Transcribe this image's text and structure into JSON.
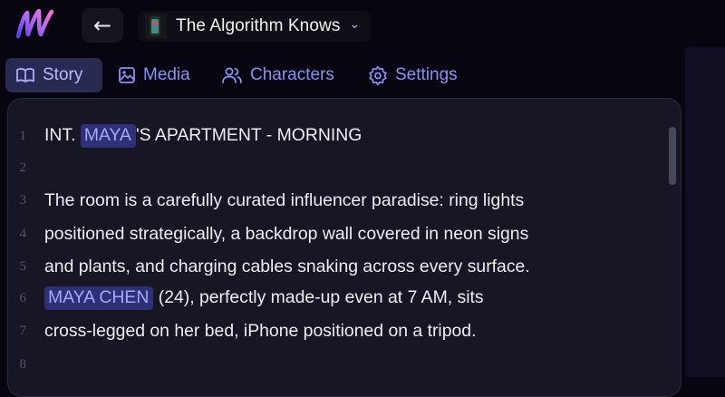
{
  "header": {
    "back_arrow": "←",
    "project_title": "The Algorithm Knows",
    "dropdown_caret": "⌄"
  },
  "tabs": [
    {
      "label": "Story",
      "icon": "book-icon",
      "active": true
    },
    {
      "label": "Media",
      "icon": "image-icon",
      "active": false
    },
    {
      "label": "Characters",
      "icon": "users-icon",
      "active": false
    },
    {
      "label": "Settings",
      "icon": "gear-icon",
      "active": false
    }
  ],
  "editor": {
    "lines": [
      {
        "num": "1",
        "pre": "INT. ",
        "char": "MAYA",
        "post": "'S APARTMENT - MORNING"
      },
      {
        "num": "2",
        "pre": "",
        "char": "",
        "post": ""
      },
      {
        "num": "3",
        "pre": "The room is a carefully curated influencer paradise: ring lights",
        "char": "",
        "post": ""
      },
      {
        "num": "4",
        "pre": "positioned strategically, a backdrop wall covered in neon signs",
        "char": "",
        "post": ""
      },
      {
        "num": "5",
        "pre": "and plants, and charging cables snaking across every surface.",
        "char": "",
        "post": ""
      },
      {
        "num": "6",
        "pre": "",
        "char": "MAYA CHEN",
        "post": " (24), perfectly made-up even at 7 AM, sits"
      },
      {
        "num": "7",
        "pre": "cross-legged on her bed, iPhone positioned on a tripod.",
        "char": "",
        "post": ""
      },
      {
        "num": "8",
        "pre": "",
        "char": "",
        "post": ""
      }
    ]
  },
  "colors": {
    "background": "#060510",
    "editor_bg": "#171624",
    "accent": "#8d8ff7",
    "character_highlight": "#2f3176"
  }
}
